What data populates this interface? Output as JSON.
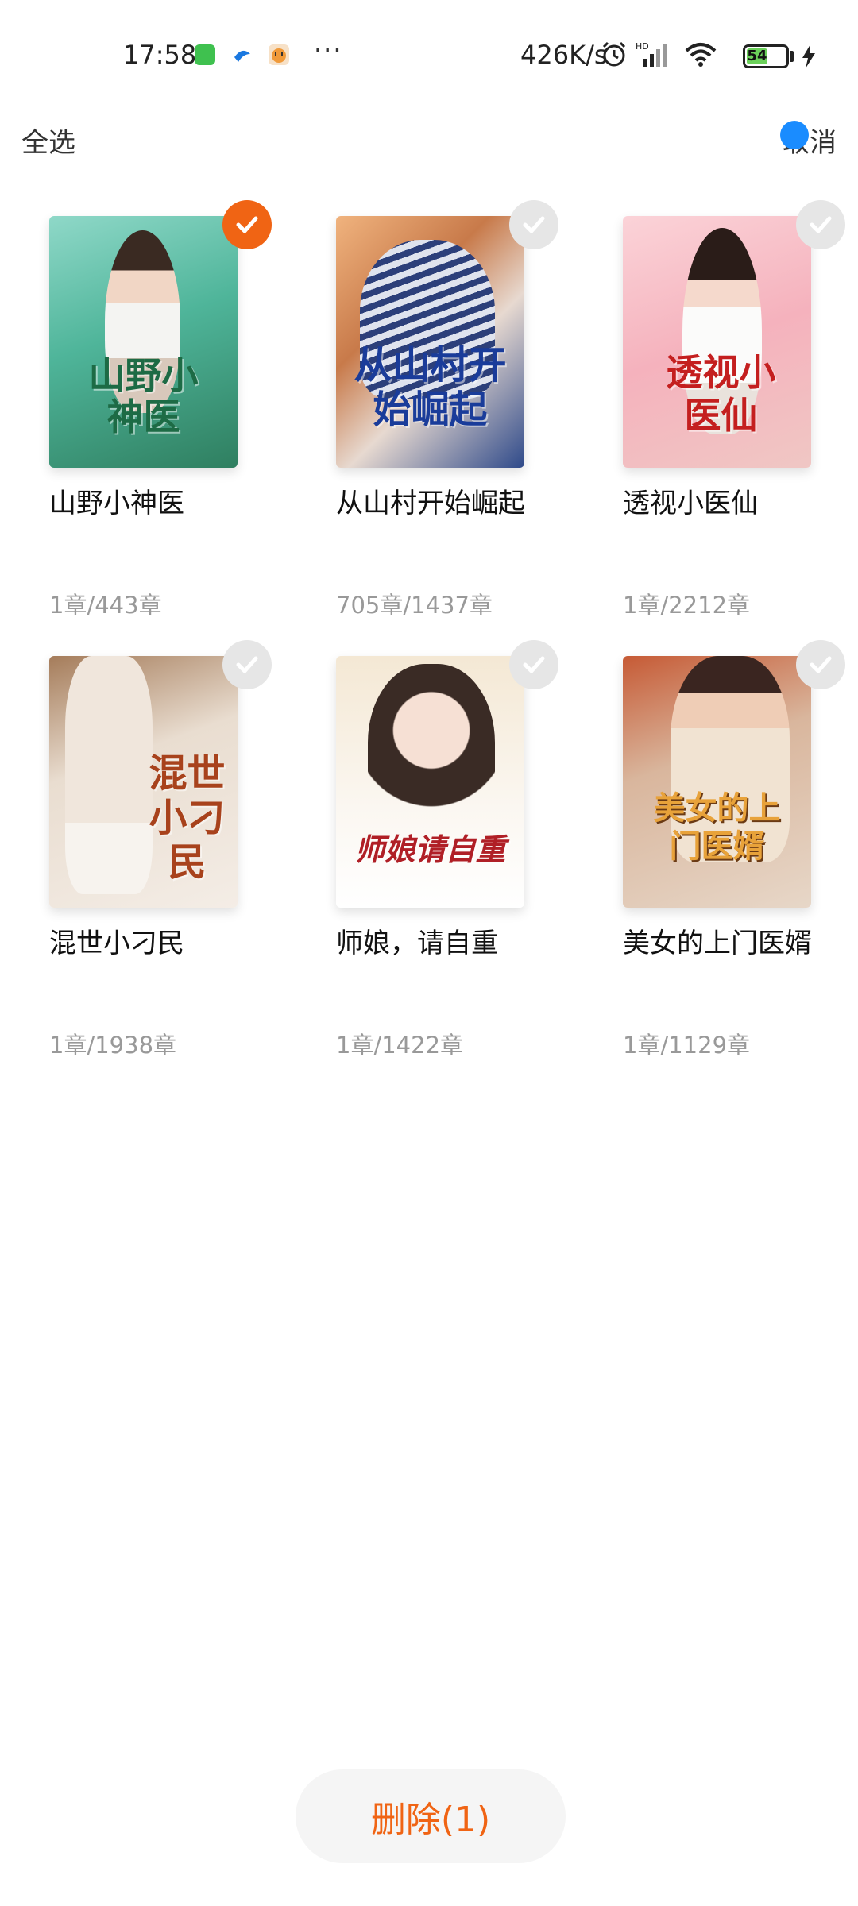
{
  "status_bar": {
    "time": "17:58",
    "net_speed": "426K/s",
    "battery_level": "54",
    "icons": [
      "wechat-icon",
      "bird-app-icon",
      "tiger-app-icon",
      "more-dots-icon",
      "alarm-icon",
      "signal-icon",
      "wifi-icon",
      "battery-icon",
      "charging-icon"
    ]
  },
  "top_bar": {
    "select_all_label": "全选",
    "cancel_label": "取消"
  },
  "books": [
    {
      "title": "山野小神医",
      "progress": "1章/443章",
      "selected": true,
      "cover_text": "山野小神医"
    },
    {
      "title": "从山村开始崛起",
      "progress": "705章/1437章",
      "selected": false,
      "cover_text": "从山村开始崛起"
    },
    {
      "title": "透视小医仙",
      "progress": "1章/2212章",
      "selected": false,
      "cover_text": "透视小医仙"
    },
    {
      "title": "混世小刁民",
      "progress": "1章/1938章",
      "selected": false,
      "cover_text": "混世小刁民"
    },
    {
      "title": "师娘，请自重",
      "progress": "1章/1422章",
      "selected": false,
      "cover_text": "师娘请自重"
    },
    {
      "title": "美女的上门医婿",
      "progress": "1章/1129章",
      "selected": false,
      "cover_text": "美女的上门医婿"
    }
  ],
  "footer": {
    "delete_label": "删除(1)"
  },
  "colors": {
    "accent": "#f06414",
    "unchecked": "#e6e6e6",
    "progress_text": "#999999"
  }
}
